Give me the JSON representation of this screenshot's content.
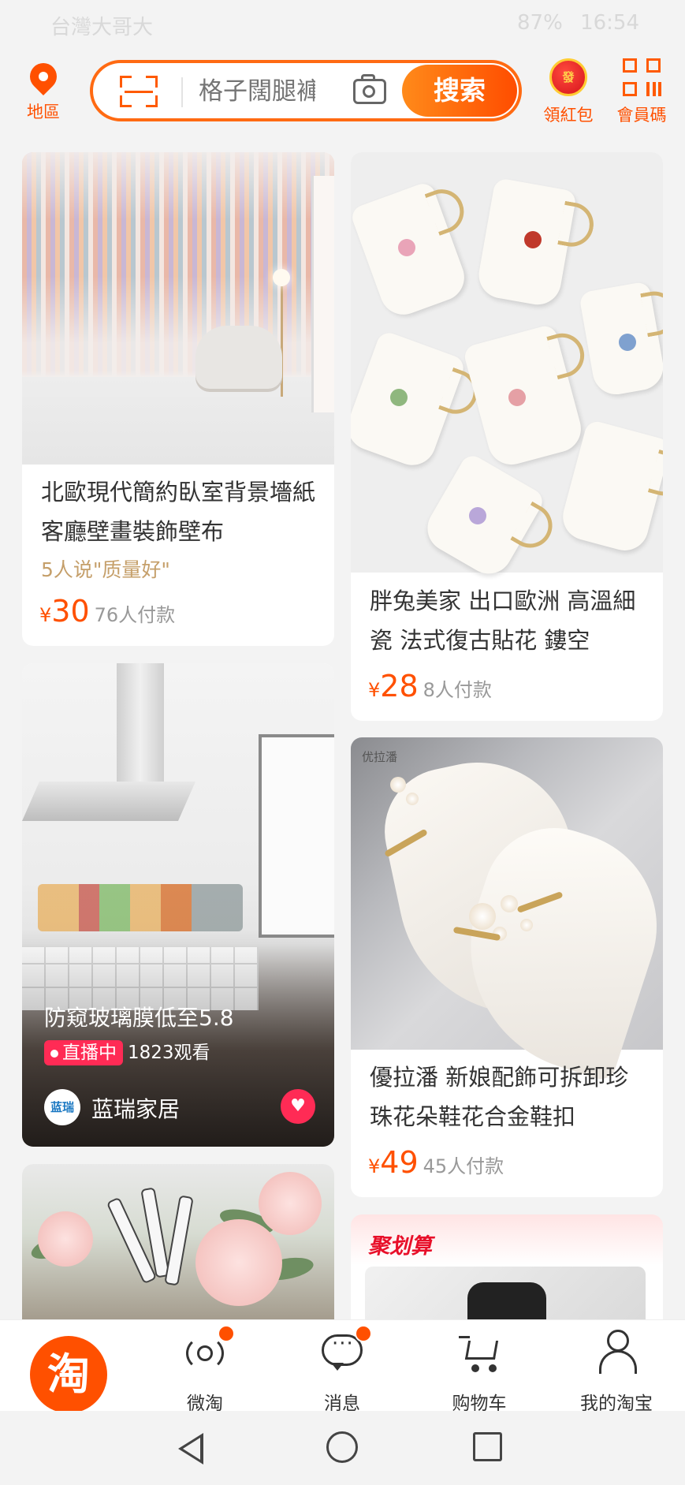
{
  "status_bar": {
    "carrier": "台灣大哥大",
    "battery": "87%",
    "time": "16:54"
  },
  "header": {
    "location_label": "地區",
    "search_placeholder": "格子闊腿褲",
    "search_button": "搜索",
    "red_packet_icon_text": "發",
    "red_packet_label": "領紅包",
    "member_code_label": "會員碼"
  },
  "feed": {
    "left": [
      {
        "title": "北歐現代簡約臥室背景墻紙客廳壁畫裝飾壁布",
        "review": "5人说\"质量好\"",
        "currency": "¥",
        "price": "30",
        "paid": "76人付款"
      },
      {
        "live_title": "防窥玻璃膜低至5.8",
        "live_tag": "直播中",
        "viewers": "1823观看",
        "shop_avatar": "蓝瑞",
        "shop_name": "蓝瑞家居"
      }
    ],
    "right": [
      {
        "title": "胖兔美家 出口歐洲 高溫細瓷 法式復古貼花 鏤空",
        "currency": "¥",
        "price": "28",
        "paid": "8人付款"
      },
      {
        "title": "優拉潘 新娘配飾可拆卸珍珠花朵鞋花合金鞋扣",
        "currency": "¥",
        "price": "49",
        "paid": "45人付款"
      }
    ],
    "juhuasuan_title": "聚划算"
  },
  "tab_bar": {
    "home_icon": "淘",
    "tabs": [
      "微淘",
      "消息",
      "购物车",
      "我的淘宝"
    ]
  },
  "colors": {
    "accent": "#ff5000",
    "live": "#ff2b55",
    "review": "#c59f6a"
  }
}
